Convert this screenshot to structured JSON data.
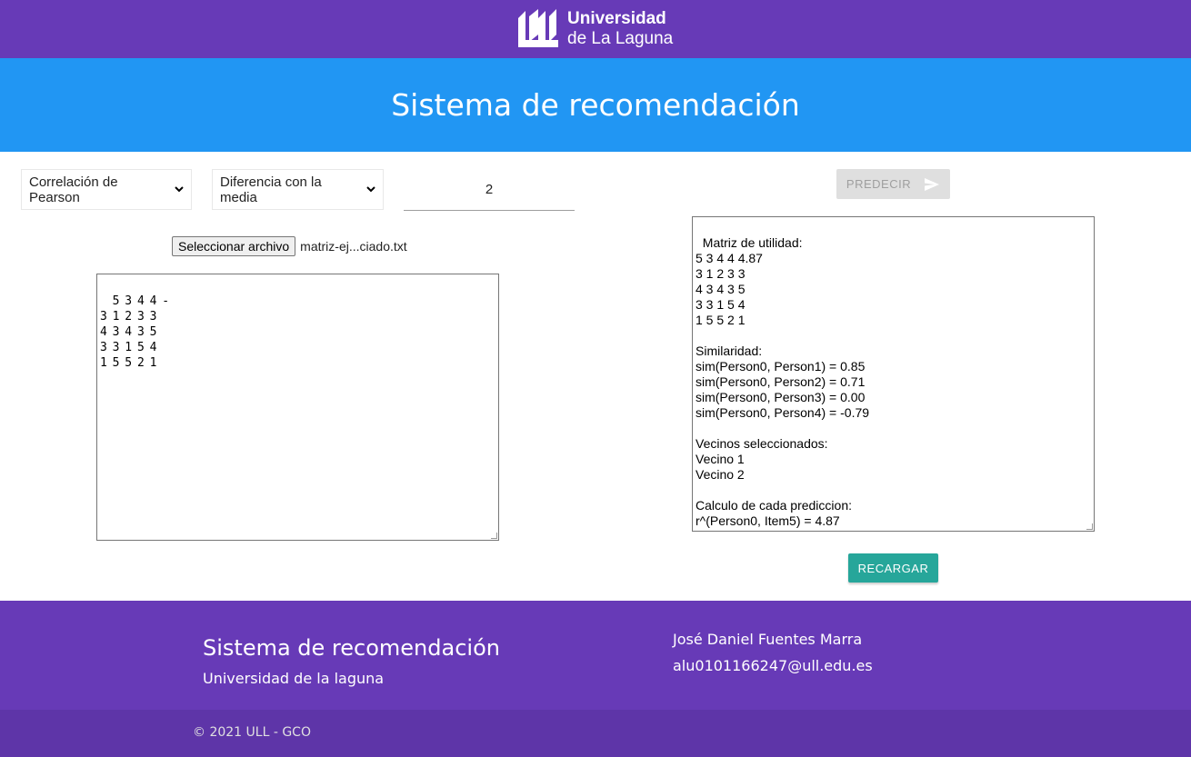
{
  "header": {
    "logo_line1": "Universidad",
    "logo_line2": "de La Laguna",
    "title": "Sistema de recomendación"
  },
  "controls": {
    "similarity_select": "Correlación de Pearson",
    "prediction_select": "Diferencia con la media",
    "neighbors_value": "2",
    "file_button": "Seleccionar archivo",
    "file_name": "matriz-ej...ciado.txt",
    "predict_label": "PREDECIR",
    "reload_label": "RECARGAR"
  },
  "input_matrix": "5 3 4 4 -\n3 1 2 3 3\n4 3 4 3 5\n3 3 1 5 4\n1 5 5 2 1",
  "output_text": "Matriz de utilidad:\n5 3 4 4 4.87\n3 1 2 3 3\n4 3 4 3 5\n3 3 1 5 4\n1 5 5 2 1\n\nSimilaridad:\nsim(Person0, Person1) = 0.85\nsim(Person0, Person2) = 0.71\nsim(Person0, Person3) = 0.00\nsim(Person0, Person4) = -0.79\n\nVecinos seleccionados:\nVecino 1\nVecino 2\n\nCalculo de cada prediccion:\nr^(Person0, Item5) = 4.87",
  "footer": {
    "title": "Sistema de recomendación",
    "subtitle": "Universidad de la laguna",
    "author": "José Daniel Fuentes Marra",
    "email": "alu0101166247@ull.edu.es",
    "copyright": "© 2021 ULL - GCO"
  },
  "colors": {
    "header_purple": "#673ab7",
    "banner_blue": "#2196f3",
    "reload_teal": "#26a69a",
    "predict_disabled": "#dfdfdf"
  }
}
